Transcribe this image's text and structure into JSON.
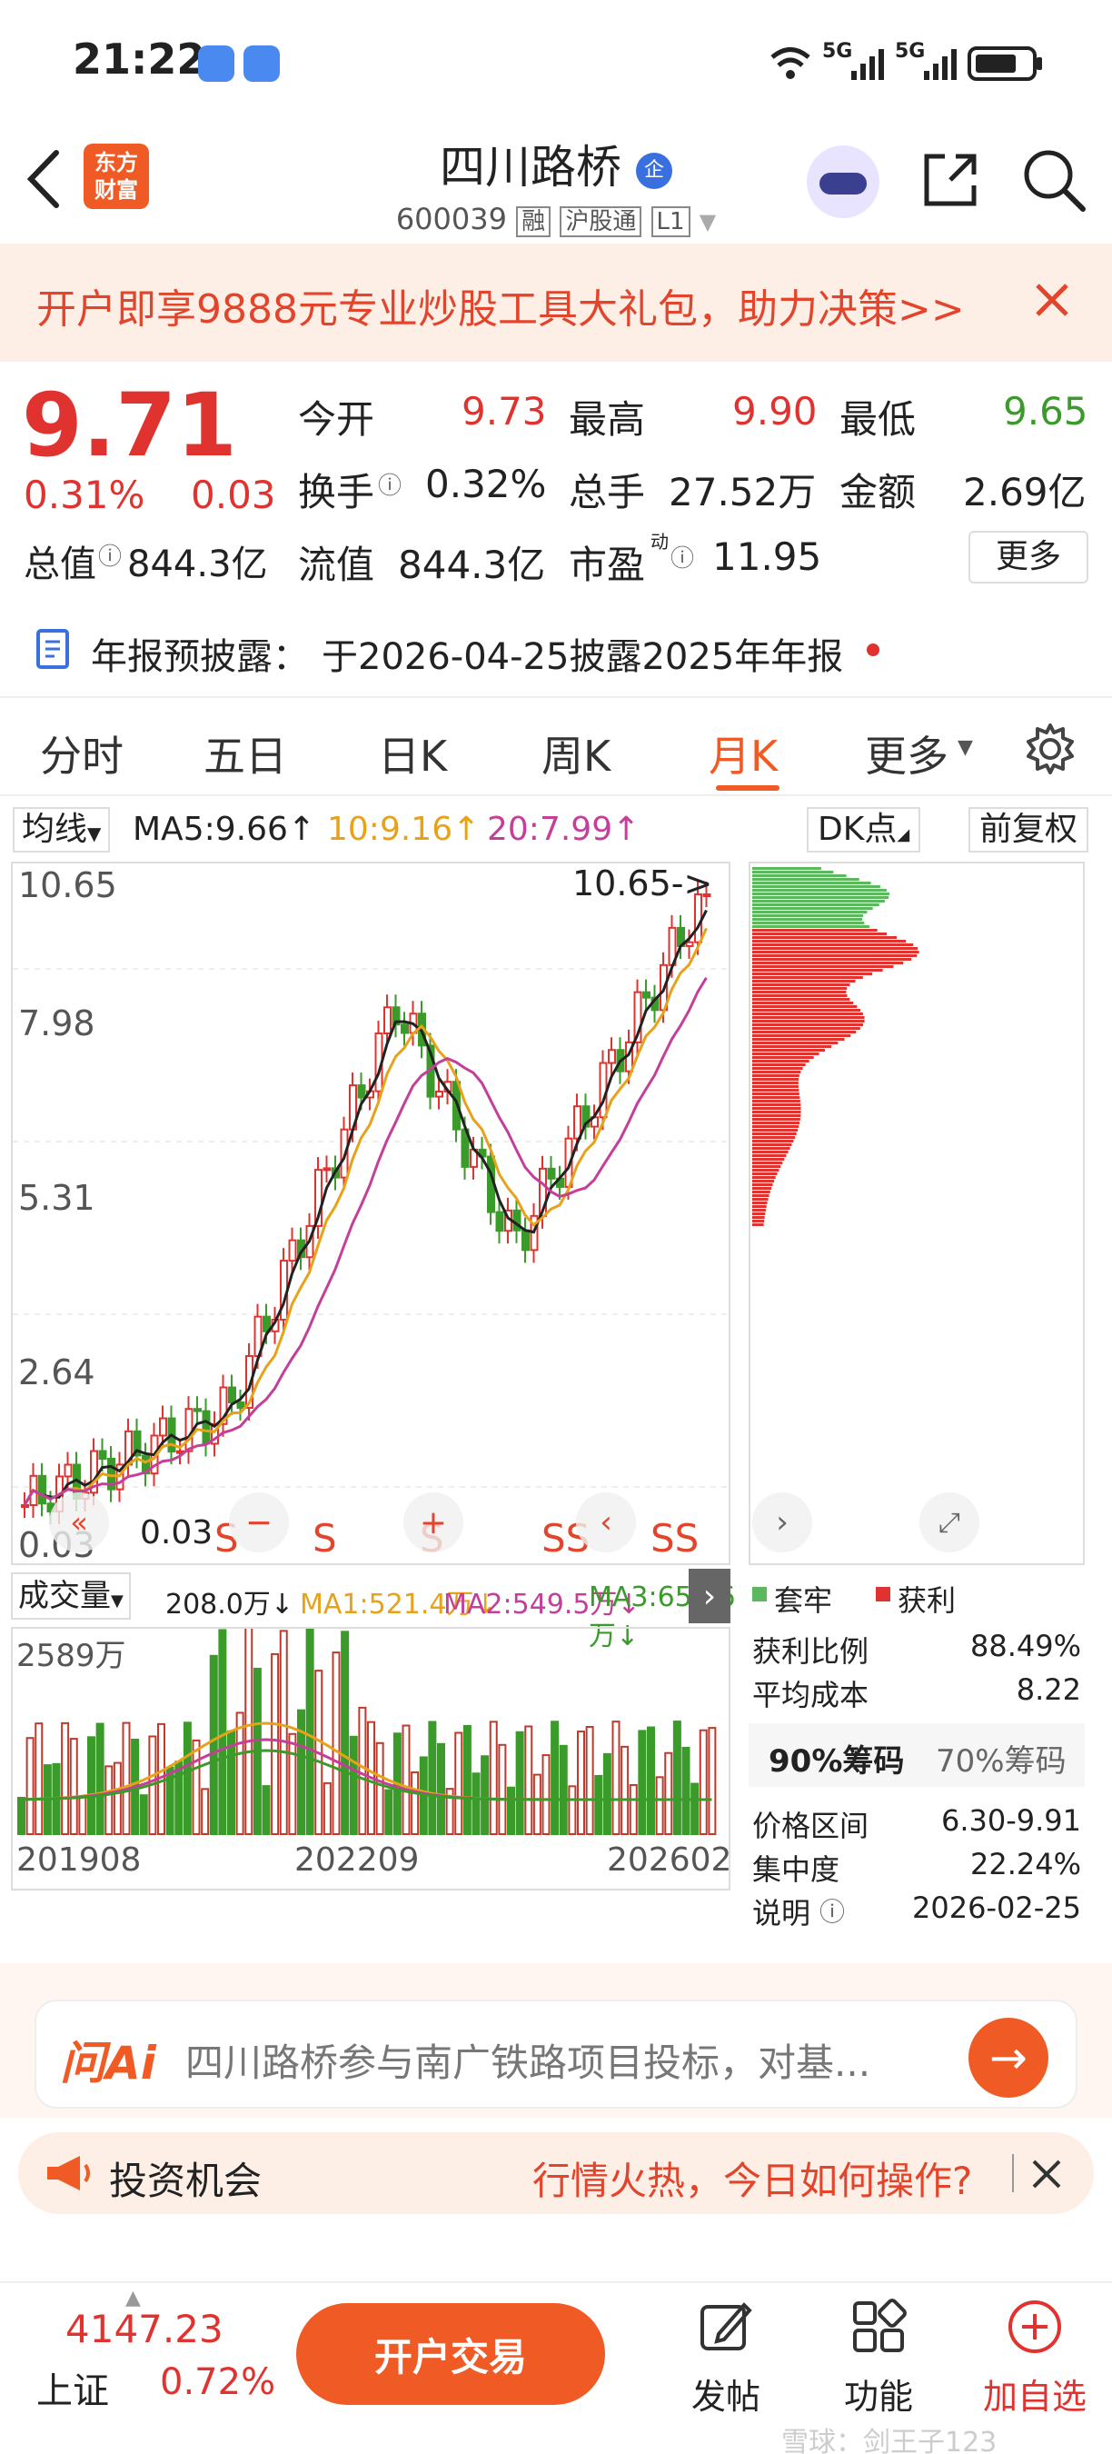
{
  "status": {
    "time": "21:22",
    "network1": "5G",
    "network2": "5G"
  },
  "header": {
    "logo_text_line1": "东方",
    "logo_text_line2": "财富",
    "stock_name": "四川路桥",
    "badge": "企",
    "code": "600039",
    "tag_margin": "融",
    "tag_connect": "沪股通",
    "tag_level": "L1"
  },
  "banner": {
    "text": "开户即享9888元专业炒股工具大礼包，助力决策>>"
  },
  "quote": {
    "price": "9.71",
    "change_pct": "0.31%",
    "change": "0.03",
    "open_label": "今开",
    "open": "9.73",
    "high_label": "最高",
    "high": "9.90",
    "low_label": "最低",
    "low": "9.65",
    "turnover_label": "换手",
    "turnover": "0.32%",
    "volume_label": "总手",
    "volume": "27.52万",
    "amount_label": "金额",
    "amount": "2.69亿",
    "mktcap_label": "总值",
    "mktcap": "844.3亿",
    "float_label": "流值",
    "float": "844.3亿",
    "pe_label": "市盈",
    "pe_sup": "动",
    "pe": "11.95",
    "more_button": "更多"
  },
  "notice": {
    "label": "年报预披露：",
    "text": "于2026-04-25披露2025年年报"
  },
  "tabs": [
    "分时",
    "五日",
    "日K",
    "周K",
    "月K",
    "更多"
  ],
  "active_tab": "月K",
  "ma_bar": {
    "select": "均线",
    "ma5": "MA5:9.66↑",
    "ma10": "10:9.16↑",
    "ma20": "20:7.99↑",
    "dk_button": "DK点",
    "adjust_button": "前复权"
  },
  "chart": {
    "y_labels": [
      "10.65",
      "7.98",
      "5.31",
      "2.64",
      "0.03"
    ],
    "max_annotation": "10.65->",
    "min_annotation": "0.03",
    "signal_marks": [
      "S",
      "S",
      "S",
      "S",
      "SS",
      "SS"
    ]
  },
  "volume": {
    "select": "成交量",
    "current": "208.0万↓",
    "ma1": "MA1:521.4万↓",
    "ma2": "MA2:549.5万↓",
    "ma3": "MA3:654.6万↓",
    "max_label": "2589万",
    "x_labels": [
      "201908",
      "202209",
      "202602"
    ]
  },
  "chip": {
    "legend_trapped": "套牢",
    "legend_profit": "获利",
    "profit_ratio_label": "获利比例",
    "profit_ratio": "88.49%",
    "avg_cost_label": "平均成本",
    "avg_cost": "8.22",
    "tab_90": "90%筹码",
    "tab_70": "70%筹码",
    "range_label": "价格区间",
    "range": "6.30-9.91",
    "concentration_label": "集中度",
    "concentration": "22.24%",
    "note_label": "说明",
    "note_date": "2026-02-25"
  },
  "ai_bar": {
    "logo": "问Ai",
    "text": "四川路桥参与南广铁路项目投标，对基..."
  },
  "opportunity": {
    "label": "投资机会",
    "text": "行情火热，今日如何操作?"
  },
  "bottom": {
    "index_value": "4147.23",
    "index_name": "上证",
    "index_change": "0.72%",
    "trade_button": "开户交易",
    "post": "发帖",
    "function": "功能",
    "add": "加自选",
    "watermark": "雪球：剑王子123"
  },
  "colors": {
    "accent": "#f05a24",
    "up": "#e0332f",
    "down": "#3a9a2a",
    "banner_bg": "#fdeee6"
  }
}
